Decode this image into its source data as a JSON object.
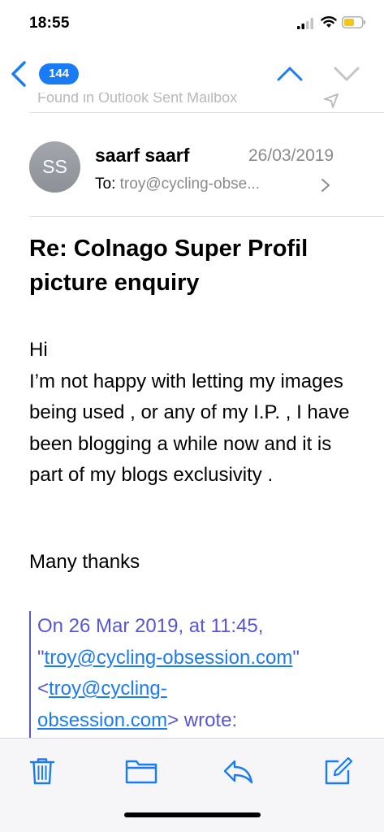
{
  "status": {
    "time": "18:55"
  },
  "nav": {
    "unread_count": "144"
  },
  "banner": {
    "text": "Found in Outlook Sent Mailbox"
  },
  "header": {
    "avatar_initials": "SS",
    "sender": "saarf saarf",
    "date": "26/03/2019",
    "to_label": "To:",
    "to_address": "troy@cycling-obse..."
  },
  "subject": "Re: Colnago Super Profil picture enquiry",
  "body": {
    "greeting": "Hi",
    "paragraph": "I’m not happy with letting my images being used , or any of my I.P. , I have been blogging a while now and it is part of my blogs exclusivity .",
    "closing": "Many thanks"
  },
  "quote": {
    "line1": "On 26 Mar 2019, at 11:45,",
    "quote_open": "\"",
    "link1": "troy@cycling-obsession.com",
    "quote_close": "\"",
    "lt": "<",
    "link2a": "troy@cycling-",
    "link2b": "obsession.com",
    "wrote": "> wrote:"
  },
  "colors": {
    "accent": "#1a7cf5",
    "quote": "#5856d6",
    "battery": "#f5c518"
  },
  "icons": [
    "back-chevron-icon",
    "chevron-up-icon",
    "chevron-down-icon",
    "trash-icon",
    "folder-icon",
    "reply-icon",
    "compose-icon"
  ]
}
